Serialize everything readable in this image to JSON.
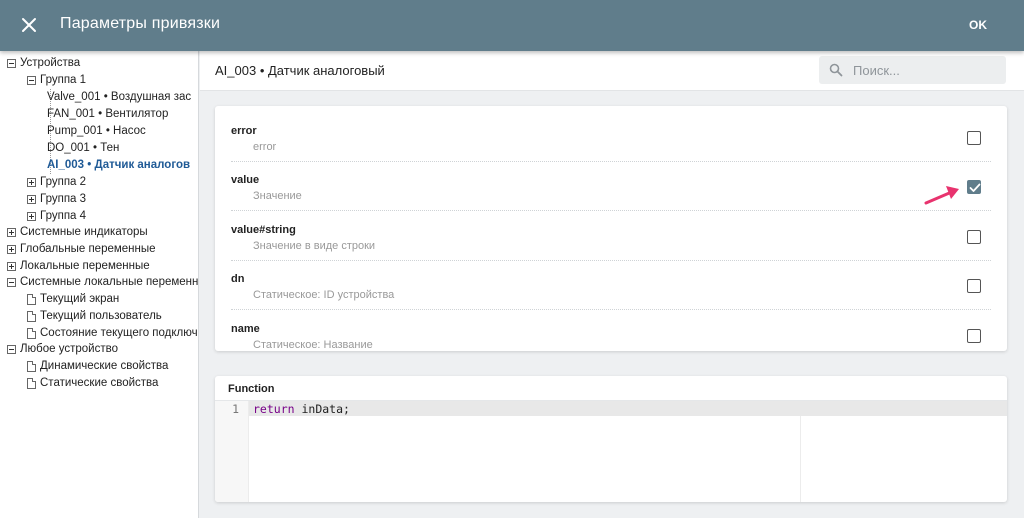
{
  "header": {
    "title": "Параметры привязки",
    "ok_label": "OK",
    "color": "#607d8b"
  },
  "tree": {
    "items": [
      {
        "label": "Устройства",
        "state": "expanded"
      },
      {
        "label": "Группа 1",
        "state": "expanded"
      },
      {
        "label": "Valve_001 • Воздушная зас",
        "state": "leaf"
      },
      {
        "label": "FAN_001 • Вентилятор",
        "state": "leaf"
      },
      {
        "label": "Pump_001 • Насос",
        "state": "leaf"
      },
      {
        "label": "DO_001 • Тен",
        "state": "leaf"
      },
      {
        "label": "AI_003 • Датчик аналогов",
        "state": "leaf",
        "selected": true
      },
      {
        "label": "Группа 2",
        "state": "collapsed"
      },
      {
        "label": "Группа 3",
        "state": "collapsed"
      },
      {
        "label": "Группа 4",
        "state": "collapsed"
      },
      {
        "label": "Системные индикаторы",
        "state": "collapsed"
      },
      {
        "label": "Глобальные переменные",
        "state": "collapsed"
      },
      {
        "label": "Локальные переменные",
        "state": "collapsed"
      },
      {
        "label": "Системные локальные переменн",
        "state": "expanded"
      },
      {
        "label": "Текущий экран",
        "state": "leaf"
      },
      {
        "label": "Текущий пользователь",
        "state": "leaf"
      },
      {
        "label": "Состояние текущего подключ",
        "state": "leaf"
      },
      {
        "label": "Любое устройство",
        "state": "expanded"
      },
      {
        "label": "Динамические свойства",
        "state": "leaf"
      },
      {
        "label": "Статические свойства",
        "state": "leaf"
      }
    ],
    "selected_color": "#1f5a96"
  },
  "device": {
    "title": "AI_003 • Датчик аналоговый"
  },
  "search": {
    "placeholder": "Поиск...",
    "value": ""
  },
  "properties": [
    {
      "name": "error",
      "description": "error",
      "checked": false
    },
    {
      "name": "value",
      "description": "Значение",
      "checked": true
    },
    {
      "name": "value#string",
      "description": "Значение в виде строки",
      "checked": false
    },
    {
      "name": "dn",
      "description": "Статическое: ID устройства",
      "checked": false
    },
    {
      "name": "name",
      "description": "Статическое: Название",
      "checked": false
    }
  ],
  "function": {
    "title": "Function",
    "lines": [
      {
        "number": "1",
        "keyword": "return",
        "rest": " inData;"
      }
    ]
  },
  "annotations": {
    "arrow_color": "#e8336e"
  }
}
